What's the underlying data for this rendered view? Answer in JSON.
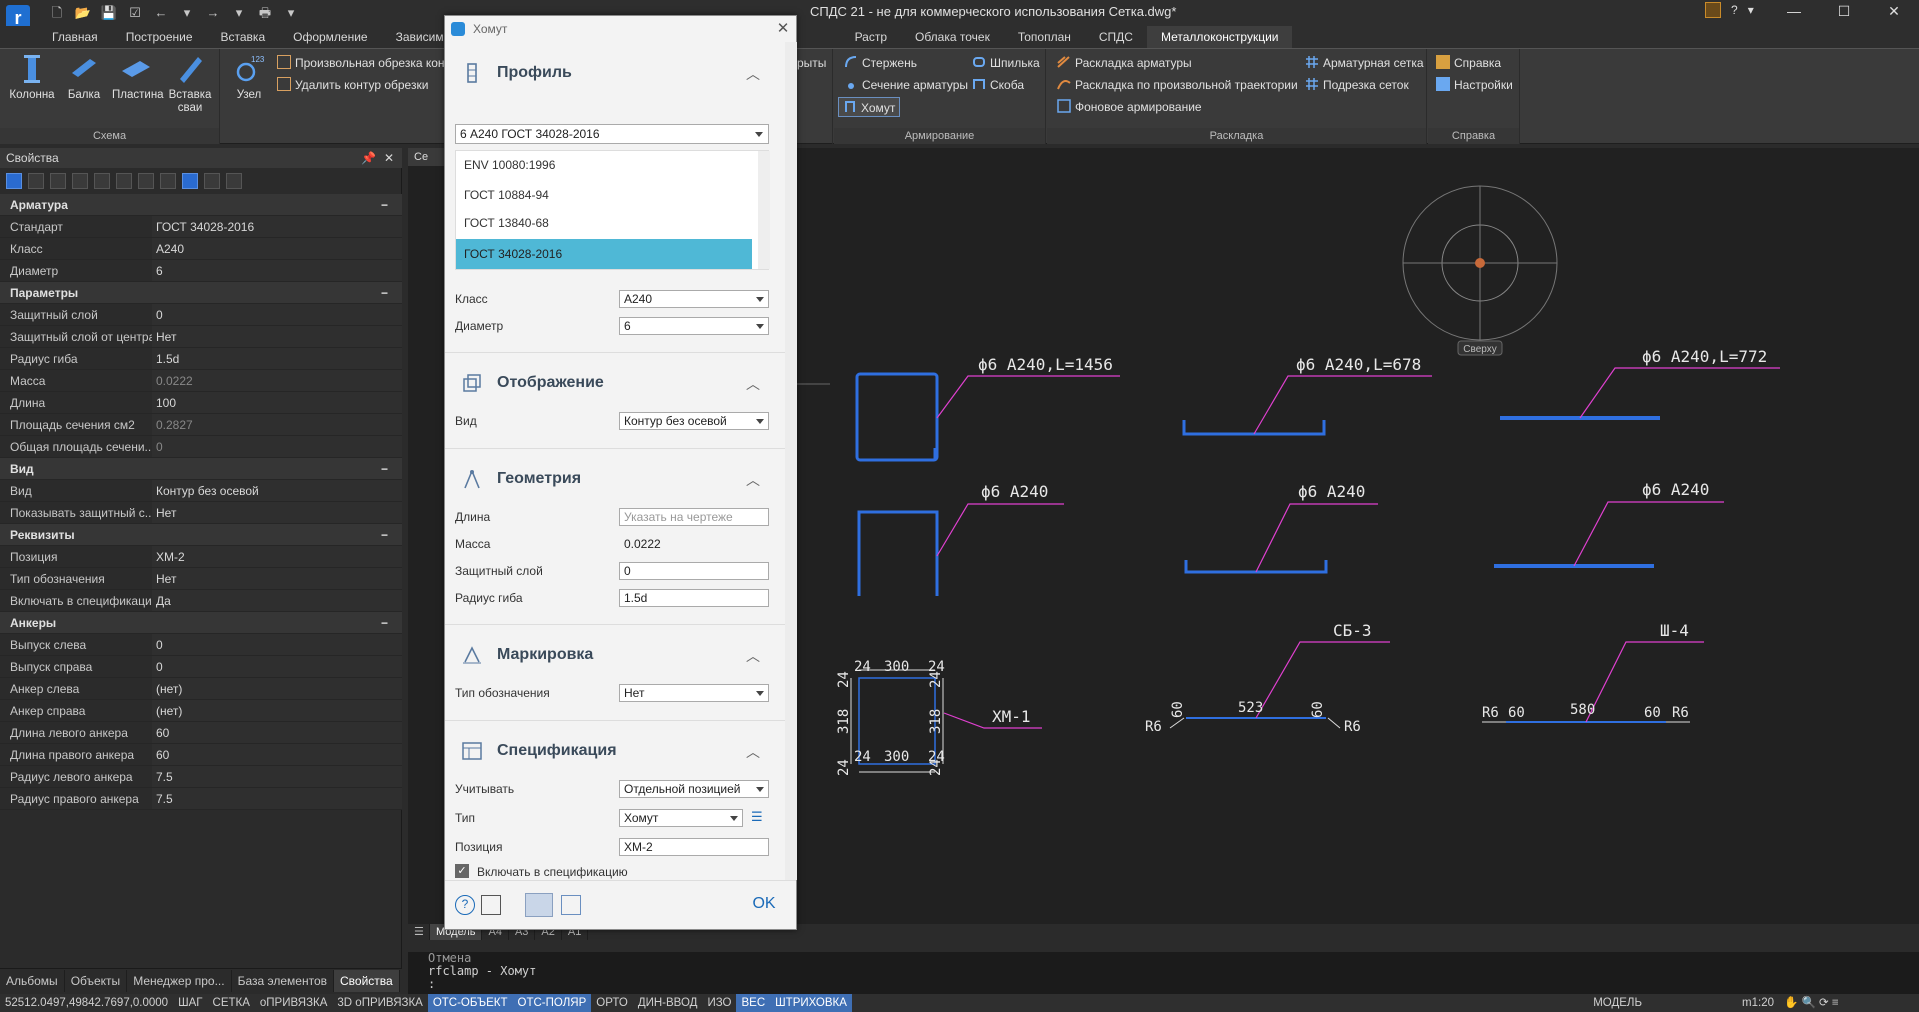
{
  "window": {
    "title": "СПДС 21 - не для коммерческого использования Сетка.dwg*"
  },
  "ribbon_tabs": [
    "Главная",
    "Построение",
    "Вставка",
    "Оформление",
    "Зависим",
    "Растр",
    "Облака точек",
    "Топоплан",
    "СПДС",
    "Металлоконструкции"
  ],
  "ribbon": {
    "schema": {
      "label": "Схема",
      "buttons": [
        "Колонна",
        "Балка",
        "Пластина",
        "Вставка сваи",
        "Узел"
      ],
      "small": [
        "Произвольная обрезка конт",
        "Удалить контур обрезки"
      ]
    },
    "partial_label": "рыты",
    "reinforcement": {
      "label": "Армирование",
      "items": [
        "Стержень",
        "Шпилька",
        "Сечение арматуры",
        "Скоба",
        "Хомут"
      ]
    },
    "layout": {
      "label": "Раскладка",
      "items": [
        "Раскладка арматуры",
        "Раскладка по произвольной траектории",
        "Фоновое армирование",
        "Арматурная сетка",
        "Подрезка сеток"
      ]
    },
    "help": {
      "label": "Справка",
      "items": [
        "Справка",
        "Настройки"
      ]
    }
  },
  "properties": {
    "title": "Свойства",
    "categories": [
      {
        "name": "Арматура",
        "rows": [
          [
            "Стандарт",
            "ГОСТ 34028-2016"
          ],
          [
            "Класс",
            "А240"
          ],
          [
            "Диаметр",
            "6"
          ]
        ]
      },
      {
        "name": "Параметры",
        "rows": [
          [
            "Защитный слой",
            "0"
          ],
          [
            "Защитный слой от центра",
            "Нет"
          ],
          [
            "Радиус гиба",
            "1.5d"
          ],
          [
            "Масса",
            "0.0222"
          ],
          [
            "Длина",
            "100"
          ],
          [
            "Площадь сечения см2",
            "0.2827"
          ],
          [
            "Общая площадь сечени...",
            "0"
          ]
        ]
      },
      {
        "name": "Вид",
        "rows": [
          [
            "Вид",
            "Контур без осевой"
          ],
          [
            "Показывать защитный с...",
            "Нет"
          ]
        ]
      },
      {
        "name": "Реквизиты",
        "rows": [
          [
            "Позиция",
            "ХМ-2"
          ],
          [
            "Тип обозначения",
            "Нет"
          ],
          [
            "Включать в спецификацию",
            "Да"
          ]
        ]
      },
      {
        "name": "Анкеры",
        "rows": [
          [
            "Выпуск слева",
            "0"
          ],
          [
            "Выпуск справа",
            "0"
          ],
          [
            "Анкер слева",
            "(нет)"
          ],
          [
            "Анкер справа",
            "(нет)"
          ],
          [
            "Длина левого анкера",
            "60"
          ],
          [
            "Длина правого анкера",
            "60"
          ],
          [
            "Радиус левого анкера",
            "7.5"
          ],
          [
            "Радиус правого анкера",
            "7.5"
          ]
        ]
      }
    ]
  },
  "bottom_tabs": [
    "Альбомы",
    "Объекты",
    "Менеджер про...",
    "База элементов",
    "Свойства"
  ],
  "layout_tabs": [
    "Модель",
    "А4",
    "А3",
    "А2",
    "А1"
  ],
  "command_lines": [
    "Отмена",
    "rfclamp - Хомут",
    ":"
  ],
  "status": {
    "coords": "52512.0497,49842.7697,0.0000",
    "toggles": [
      "ШАГ",
      "СЕТКА",
      "оПРИВЯЗКА",
      "3D оПРИВЯЗКА",
      "ОТС-ОБЪЕКТ",
      "ОТС-ПОЛЯР",
      "ОРТО",
      "ДИН-ВВОД",
      "ИЗО",
      "ВЕС",
      "ШТРИХОВКА"
    ],
    "toggles_on": [
      "ОТС-ОБЪЕКТ",
      "ОТС-ПОЛЯР",
      "ВЕС",
      "ШТРИХОВКА"
    ],
    "mode": "МОДЕЛЬ",
    "scale": "m1:20"
  },
  "viewcube_label": "Сверху",
  "drawing": {
    "labels": [
      "ϕ6 А240,L=1456",
      "ϕ6 А240,L=678",
      "ϕ6 А240,L=772",
      "ϕ6 А240",
      "ϕ6 А240",
      "ϕ6 А240",
      "ХМ-1",
      "СБ-3",
      "Ш-4"
    ],
    "dims_clamp": [
      "24",
      "300",
      "24",
      "24",
      "300",
      "24",
      "318",
      "318",
      "24",
      "24",
      "24",
      "24"
    ],
    "dims_sb": [
      "R6",
      "60",
      "523",
      "60",
      "R6"
    ],
    "dims_sh": [
      "R6",
      "60",
      "580",
      "60",
      "R6"
    ]
  },
  "dialog": {
    "title": "Хомут",
    "sections": {
      "profile": "Профиль",
      "display": "Отображение",
      "geometry": "Геометрия",
      "marking": "Маркировка",
      "spec": "Спецификация"
    },
    "standard_value": "6 А240 ГОСТ 34028-2016",
    "standard_list": [
      "ENV 10080:1996",
      "ГОСТ 10884-94",
      "ГОСТ 13840-68",
      "ГОСТ 34028-2016"
    ],
    "fields": {
      "class_label": "Класс",
      "class_value": "А240",
      "diameter_label": "Диаметр",
      "diameter_value": "6",
      "view_label": "Вид",
      "view_value": "Контур без осевой",
      "length_label": "Длина",
      "length_placeholder": "Указать на чертеже",
      "mass_label": "Масса",
      "mass_value": "0.0222",
      "cover_label": "Защитный слой",
      "cover_value": "0",
      "bend_label": "Радиус гиба",
      "bend_value": "1.5d",
      "mark_type_label": "Тип обозначения",
      "mark_type_value": "Нет",
      "account_label": "Учитывать",
      "account_value": "Отдельной позицией",
      "type_label": "Тип",
      "type_value": "Хомут",
      "position_label": "Позиция",
      "position_value": "ХМ-2",
      "include_label": "Включать в спецификацию"
    },
    "ok": "OK"
  },
  "colors": {
    "rebar": "#2f6fe0",
    "leader": "#e040d0",
    "accent": "#4fb8d6"
  }
}
